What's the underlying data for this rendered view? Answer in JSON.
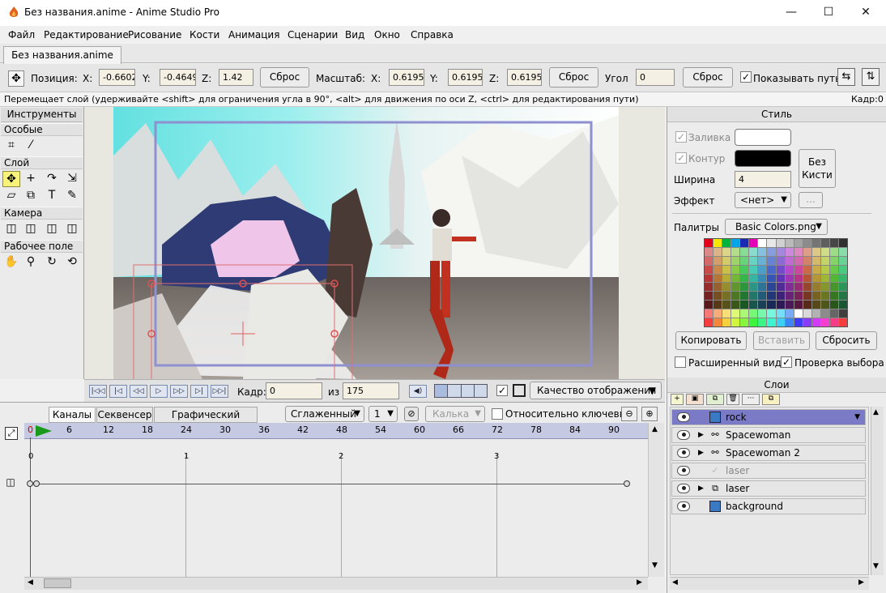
{
  "window": {
    "title": "Без названия.anime - Anime Studio Pro",
    "minimize": "—",
    "maximize": "☐",
    "close": "✕"
  },
  "menu": [
    "Файл",
    "Редактирование",
    "Рисование",
    "Кости",
    "Анимация",
    "Сценарии",
    "Вид",
    "Окно",
    "Справка"
  ],
  "doc_tab": "Без названия.anime",
  "tool_options": {
    "position_label": "Позиция:",
    "x_label": "X:",
    "x_value": "-0.6602",
    "y_label": "Y:",
    "y_value": "-0.4649",
    "z_label": "Z:",
    "z_value": "1.42",
    "reset1": "Сброс",
    "scale_label": "Масштаб:",
    "sx_label": "X:",
    "sx_value": "0.6195",
    "sy_label": "Y:",
    "sy_value": "0.6195",
    "sz_label": "Z:",
    "sz_value": "0.6195",
    "reset2": "Сброс",
    "angle_label": "Угол",
    "angle_value": "0",
    "reset3": "Сброс",
    "show_path": "Показывать путь"
  },
  "status": {
    "hint": "Перемещает слой (удерживайте <shift> для ограничения угла в 90°, <alt> для движения по оси Z, <ctrl> для редактирования пути)",
    "frame": "Кадр:0"
  },
  "tools": {
    "header": "Инструменты",
    "sections": [
      "Особые",
      "Слой",
      "Камера",
      "Рабочее поле"
    ]
  },
  "playback": {
    "frame_label": "Кадр:",
    "frame_value": "0",
    "of_label": "из",
    "total": "175",
    "quality": "Качество отображения"
  },
  "timeline": {
    "tabs": [
      "Каналы",
      "Секвенсер",
      "Графический режим"
    ],
    "interp": "Сглаженный",
    "interp_num": "1",
    "onion": "Калька",
    "relative": "Относительно ключевых",
    "ruler": [
      "0",
      "6",
      "12",
      "18",
      "24",
      "30",
      "36",
      "42",
      "48",
      "54",
      "60",
      "66",
      "72",
      "78",
      "84",
      "90"
    ],
    "seconds": [
      "0",
      "1",
      "2",
      "3"
    ]
  },
  "style": {
    "header": "Стиль",
    "fill": "Заливка",
    "stroke": "Контур",
    "width_label": "Ширина",
    "width_value": "4",
    "no_brush_1": "Без",
    "no_brush_2": "Кисти",
    "effect_label": "Эффект",
    "effect_value": "<нет>",
    "effect_more": "...",
    "palettes_label": "Палитры",
    "palette_name": "Basic Colors.png",
    "copy": "Копировать",
    "paste": "Вставить",
    "reset": "Сбросить",
    "advanced": "Расширенный вид",
    "check_sel": "Проверка выбора",
    "fill_color": "#ffffff",
    "stroke_color": "#000000"
  },
  "layers": {
    "header": "Слои",
    "items": [
      {
        "name": "rock",
        "selected": true
      },
      {
        "name": "Spacewoman",
        "selected": false
      },
      {
        "name": "Spacewoman 2",
        "selected": false
      },
      {
        "name": "laser",
        "selected": false
      },
      {
        "name": "laser",
        "selected": false
      },
      {
        "name": "background",
        "selected": false
      }
    ]
  }
}
